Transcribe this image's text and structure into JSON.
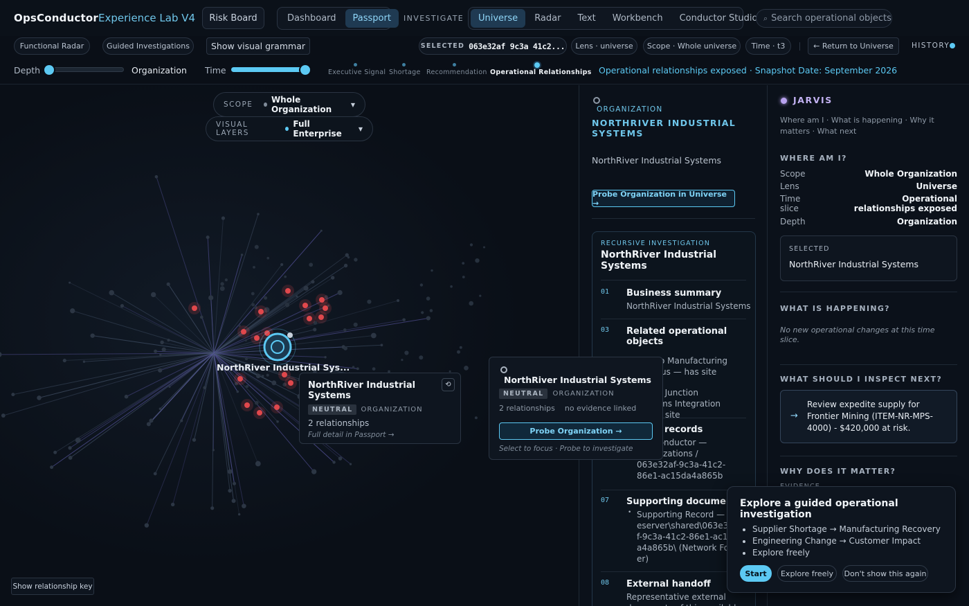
{
  "header": {
    "brand": "OpsConductor",
    "brand_sub": "Experience Lab V4",
    "risk_board": "Risk Board",
    "nav_tabs": [
      "Dashboard",
      "Passport"
    ],
    "nav_active": "Passport",
    "investigate_label": "INVESTIGATE",
    "investigate_tabs": [
      "Universe",
      "Radar",
      "Text",
      "Workbench",
      "Conductor Studio"
    ],
    "investigate_active": "Universe",
    "search_placeholder": "Search operational objects"
  },
  "toolbar": {
    "functional_radar": "Functional Radar",
    "guided_investigations": "Guided Investigations",
    "show_visual_grammar": "Show visual grammar",
    "selected_label": "SELECTED",
    "selected_value": "063e32af 9c3a 41c2...",
    "lens_chip": "Lens · universe",
    "scope_chip": "Scope · Whole universe",
    "time_chip": "Time · t3",
    "return_button": "← Return to Universe",
    "history_label": "HISTORY"
  },
  "controls": {
    "depth_label": "Depth",
    "depth_value": "Organization",
    "depth_level": 0.0,
    "time_label": "Time",
    "time_level": 1.0,
    "timeline_stops": [
      "Executive Signal",
      "Shortage",
      "Recommendation",
      "Operational Relationships"
    ],
    "timeline_active": "Operational Relationships",
    "snapshot_text": "Operational relationships exposed · Snapshot Date: September 2026"
  },
  "graph": {
    "scope_label": "SCOPE",
    "scope_value": "Whole Organization",
    "layers_label": "VISUAL LAYERS",
    "layers_value": "Full Enterprise",
    "node_label": "NorthRiver Industrial Sys...",
    "hover_card": {
      "title": "NorthRiver Industrial Systems",
      "badge": "NEUTRAL",
      "type": "ORGANIZATION",
      "relationships": "2 relationships",
      "hint": "Full detail in Passport →"
    },
    "popover": {
      "title": "NorthRiver Industrial Systems",
      "badge": "NEUTRAL",
      "type": "ORGANIZATION",
      "relationships": "2 relationships",
      "evidence": "no evidence linked",
      "probe_button": "Probe Organization →",
      "hint": "Select to focus · Probe to investigate"
    },
    "relationship_key_button": "Show relationship key"
  },
  "passport": {
    "type_label": "ORGANIZATION",
    "title": "NORTHRIVER INDUSTRIAL SYSTEMS",
    "subtitle": "NorthRiver Industrial Systems",
    "probe_button": "Probe Organization in Universe →",
    "investigation": {
      "label": "RECURSIVE INVESTIGATION",
      "title": "NorthRiver Industrial Systems",
      "items": [
        {
          "num": "01",
          "title": "Business summary",
          "body": "NorthRiver Industrial Systems"
        },
        {
          "num": "03",
          "title": "Related operational objects",
          "bullets": [
            "Pueblo Manufacturing Campus — has site",
            "Grand Junction Systems Integration — has site"
          ]
        },
        {
          "num": "",
          "title": "Source records",
          "bullets": [
            "OpsConductor — organizations / 063e32af-9c3a-41c2-86e1-ac15da4a865b"
          ]
        },
        {
          "num": "07",
          "title": "Supporting documents",
          "bullets": [
            "Supporting Record — \\\\fileserver\\shared\\063e32af-9c3a-41c2-86e1-ac15da4a865b\\ (Network Folder)"
          ]
        },
        {
          "num": "08",
          "title": "External handoff",
          "body": "Representative external documents of this available"
        }
      ]
    }
  },
  "jarvis": {
    "title": "JARVIS",
    "tagline": "Where am I · What is happening · Why it matters · What next",
    "where_heading": "WHERE AM I?",
    "rows": [
      {
        "k": "Scope",
        "v": "Whole Organization"
      },
      {
        "k": "Lens",
        "v": "Universe"
      },
      {
        "k": "Time slice",
        "v": "Operational relationships exposed"
      },
      {
        "k": "Depth",
        "v": "Organization"
      }
    ],
    "selected_label": "SELECTED",
    "selected_value": "NorthRiver Industrial Systems",
    "happening_heading": "WHAT IS HAPPENING?",
    "happening_text": "No new operational changes at this time slice.",
    "inspect_heading": "WHAT SHOULD I INSPECT NEXT?",
    "inspect_text": "Review expedite supply for Frontier Mining (ITEM-NR-MPS-4000) - $420,000 at risk.",
    "matter_heading": "WHY DOES IT MATTER?",
    "evidence_label": "EVIDENCE"
  },
  "guide": {
    "title": "Explore a guided operational investigation",
    "items": [
      "Supplier Shortage → Manufacturing Recovery",
      "Engineering Change → Customer Impact",
      "Explore freely"
    ],
    "start": "Start",
    "explore": "Explore freely",
    "dismiss": "Don't show this again"
  },
  "colors": {
    "accent": "#5cc9f3",
    "danger": "#e0484c",
    "jarvis": "#b9a3f0"
  }
}
